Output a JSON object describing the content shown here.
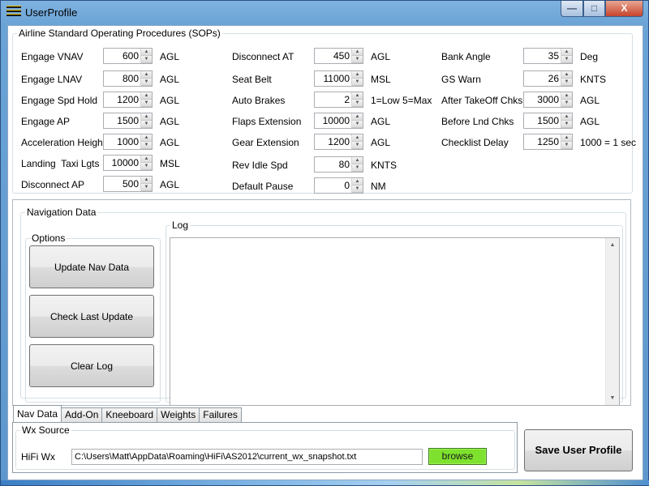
{
  "window": {
    "title": "UserProfile",
    "controls": {
      "minimize": "—",
      "maximize": "□",
      "close": "X"
    }
  },
  "sops": {
    "legend": "Airline Standard Operating Procedures (SOPs)",
    "col1": [
      {
        "label": "Engage VNAV",
        "value": "600",
        "unit": "AGL"
      },
      {
        "label": "Engage LNAV",
        "value": "800",
        "unit": "AGL"
      },
      {
        "label": "Engage Spd Hold",
        "value": "1200",
        "unit": "AGL"
      },
      {
        "label": "Engage AP",
        "value": "1500",
        "unit": "AGL"
      },
      {
        "label": "Acceleration Height",
        "value": "1000",
        "unit": "AGL"
      },
      {
        "label": "Landing  Taxi Lgts",
        "value": "10000",
        "unit": "MSL"
      },
      {
        "label": "Disconnect AP",
        "value": "500",
        "unit": "AGL"
      }
    ],
    "col2": [
      {
        "label": "Disconnect AT",
        "value": "450",
        "unit": "AGL"
      },
      {
        "label": "Seat Belt",
        "value": "11000",
        "unit": "MSL"
      },
      {
        "label": "Auto Brakes",
        "value": "2",
        "unit": "1=Low 5=Max"
      },
      {
        "label": "Flaps Extension",
        "value": "10000",
        "unit": "AGL"
      },
      {
        "label": "Gear Extension",
        "value": "1200",
        "unit": "AGL"
      },
      {
        "label": "Rev Idle Spd",
        "value": "80",
        "unit": "KNTS"
      },
      {
        "label": "Default Pause",
        "value": "0",
        "unit": "NM"
      }
    ],
    "col3": [
      {
        "label": "Bank Angle",
        "value": "35",
        "unit": "Deg"
      },
      {
        "label": "GS Warn",
        "value": "26",
        "unit": "KNTS"
      },
      {
        "label": "After TakeOff Chks",
        "value": "3000",
        "unit": "AGL"
      },
      {
        "label": "Before Lnd Chks",
        "value": "1500",
        "unit": "AGL"
      },
      {
        "label": "Checklist Delay",
        "value": "1250",
        "unit": "1000 = 1 sec"
      }
    ]
  },
  "nav": {
    "legend": "Navigation Data",
    "options_legend": "Options",
    "buttons": {
      "update": "Update Nav Data",
      "check": "Check Last Update",
      "clear": "Clear Log"
    },
    "log_legend": "Log",
    "scroll_up": "▲",
    "scroll_down": "▼"
  },
  "tabs": [
    "Nav Data",
    "Add-On",
    "Kneeboard",
    "Weights",
    "Failures"
  ],
  "active_tab": "Nav Data",
  "wx": {
    "legend": "Wx Source",
    "label": "HiFi Wx",
    "path": "C:\\Users\\Matt\\AppData\\Roaming\\HiFi\\AS2012\\current_wx_snapshot.txt",
    "browse": "browse"
  },
  "save_button": "Save User Profile",
  "colors": {
    "titlebar": "#6aa3d6",
    "browse_green": "#7ee12e",
    "close_red": "#c7432a"
  }
}
